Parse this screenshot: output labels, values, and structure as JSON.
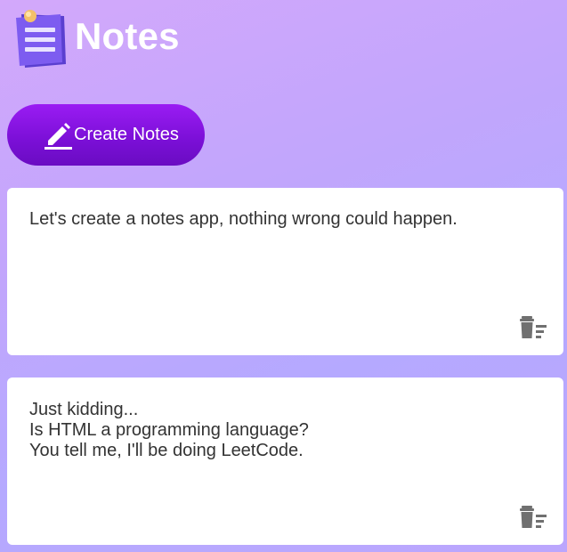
{
  "header": {
    "title": "Notes",
    "logo_icon": "notes-logo-icon"
  },
  "toolbar": {
    "create_label": "Create Notes",
    "create_icon": "pencil-icon"
  },
  "notes": [
    {
      "text": "Let's create a notes app, nothing wrong could happen."
    },
    {
      "text": "Just kidding...\nIs HTML a programming language?\nYou tell me, I'll be doing LeetCode."
    }
  ],
  "colors": {
    "accent": "#8a14e6",
    "icon_gray": "#707070",
    "text": "#333333"
  },
  "icons": {
    "delete": "trash-icon"
  }
}
